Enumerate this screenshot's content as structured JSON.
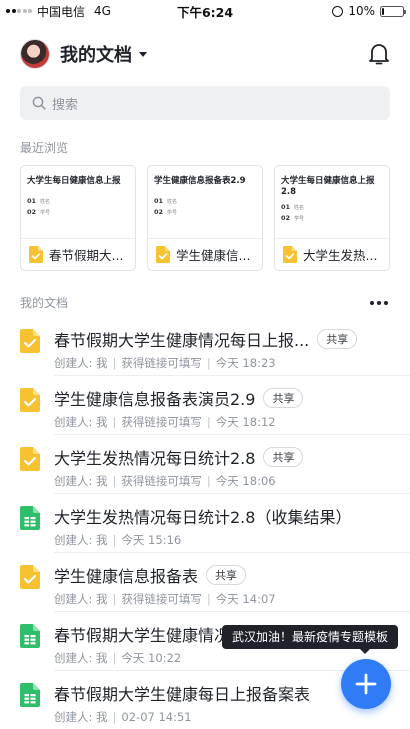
{
  "status_bar": {
    "carrier": "中国电信",
    "network": "4G",
    "time": "下午6:24",
    "battery": "10%",
    "battery_level": 0.1
  },
  "header": {
    "title": "我的文档",
    "avatar": "user-avatar",
    "bell_icon": "bell-icon"
  },
  "search": {
    "placeholder": "搜索"
  },
  "recent": {
    "label": "最近浏览",
    "cards": [
      {
        "preview_title": "大学生每日健康信息上报",
        "field1": "01",
        "field1_label": "姓名",
        "field2": "02",
        "field2_label": "学号",
        "name": "春节假期大..."
      },
      {
        "preview_title": "学生健康信息报备表2.9",
        "field1": "01",
        "field1_label": "姓名",
        "field2": "02",
        "field2_label": "学号",
        "name": "学生健康信..."
      },
      {
        "preview_title": "大学生每日健康信息上报2.8",
        "field1": "01",
        "field1_label": "姓名",
        "field2": "02",
        "field2_label": "学号",
        "name": "大学生发热..."
      }
    ]
  },
  "docs": {
    "label": "我的文档",
    "items": [
      {
        "title": "春节假期大学生健康情况每日上报...",
        "shared": "共享",
        "creator": "创建人: 我",
        "link": "获得链接可填写",
        "time": "今天 18:23",
        "type": "form"
      },
      {
        "title": "学生健康信息报备表演员2.9",
        "shared": "共享",
        "creator": "创建人: 我",
        "link": "获得链接可填写",
        "time": "今天 18:12",
        "type": "form"
      },
      {
        "title": "大学生发热情况每日统计2.8",
        "shared": "共享",
        "creator": "创建人: 我",
        "link": "获得链接可填写",
        "time": "今天 18:06",
        "type": "form"
      },
      {
        "title": "大学生发热情况每日统计2.8（收集结果）",
        "shared": "",
        "creator": "创建人: 我",
        "link": "",
        "time": "今天 15:16",
        "type": "sheet"
      },
      {
        "title": "学生健康信息报备表",
        "shared": "共享",
        "creator": "创建人: 我",
        "link": "获得链接可填写",
        "time": "今天 14:07",
        "type": "form"
      },
      {
        "title": "春节假期大学生健康情况",
        "shared": "",
        "creator": "创建人: 我",
        "link": "",
        "time": "今天 10:22",
        "type": "sheet"
      },
      {
        "title": "春节假期大学生健康每日上报备案表",
        "shared": "",
        "creator": "创建人: 我",
        "link": "",
        "time": "02-07 14:51",
        "type": "sheet"
      }
    ]
  },
  "tooltip": {
    "text": "武汉加油！最新疫情专题模板"
  },
  "colors": {
    "accent": "#2f7cf6",
    "form_icon": "#f7c130",
    "sheet_icon": "#2fbf6b"
  }
}
